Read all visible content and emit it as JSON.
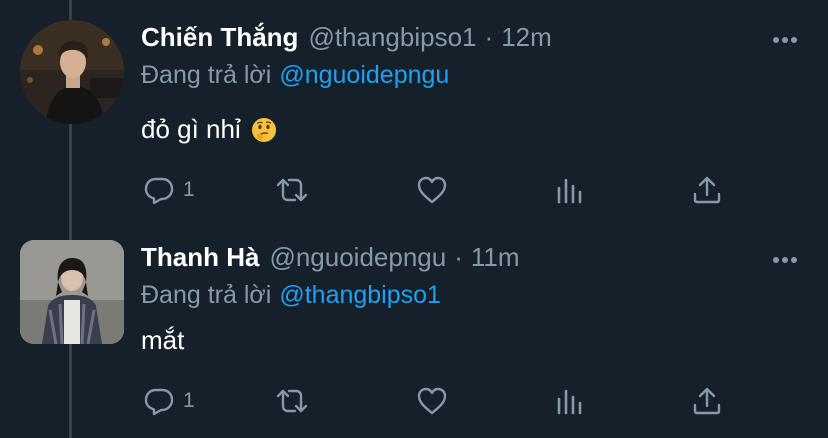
{
  "tweets": [
    {
      "display_name": "Chiến Thắng",
      "handle": "@thangbipso1",
      "separator": "·",
      "time": "12m",
      "reply_prefix": "Đang trả lời",
      "reply_to": "@nguoidepngu",
      "text": "đỏ gì nhỉ",
      "emoji": "thinking-face",
      "reply_count": "1",
      "avatar_shape": "circle"
    },
    {
      "display_name": "Thanh Hà",
      "handle": "@nguoidepngu",
      "separator": "·",
      "time": "11m",
      "reply_prefix": "Đang trả lời",
      "reply_to": "@thangbipso1",
      "text": "mắt",
      "reply_count": "1",
      "avatar_shape": "rounded-square"
    }
  ],
  "icons": {
    "more": "more-horizontal-icon",
    "reply": "reply-bubble-icon",
    "retweet": "retweet-icon",
    "like": "heart-icon",
    "stats": "analytics-bars-icon",
    "share": "share-upload-icon"
  },
  "colors": {
    "background": "#15202b",
    "thread_line": "#38444d",
    "secondary_text": "#8899a6",
    "mention": "#1da1f2",
    "primary_text": "#ffffff"
  }
}
